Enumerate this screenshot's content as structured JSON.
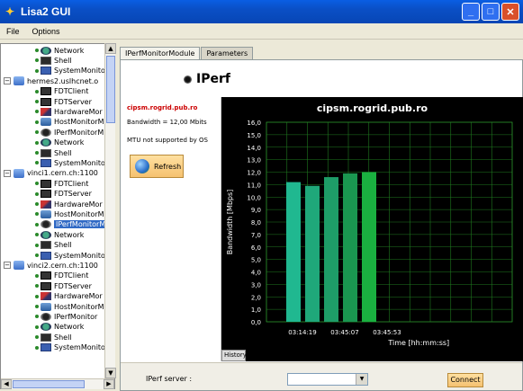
{
  "window": {
    "title": "Lisa2 GUI"
  },
  "menu": [
    "File",
    "Options"
  ],
  "tree": [
    {
      "label": "Network",
      "icon": "network-icon",
      "indent": 2,
      "top": 0
    },
    {
      "label": "Shell",
      "icon": "shell-icon",
      "indent": 2
    },
    {
      "label": "SystemMonito",
      "icon": "system-monitor-icon",
      "indent": 2
    },
    {
      "label": "hermes2.uslhcnet.o",
      "icon": "farm-icon",
      "indent": 0
    },
    {
      "label": "FDTClient",
      "icon": "fdt-client-icon",
      "indent": 2
    },
    {
      "label": "FDTServer",
      "icon": "fdt-server-icon",
      "indent": 2
    },
    {
      "label": "HardwareMor",
      "icon": "hardware-monitor-icon",
      "indent": 2
    },
    {
      "label": "HostMonitorM",
      "icon": "host-monitor-icon",
      "indent": 2
    },
    {
      "label": "IPerfMonitorM",
      "icon": "iperf-monitor-icon",
      "indent": 2
    },
    {
      "label": "Network",
      "icon": "network-icon",
      "indent": 2
    },
    {
      "label": "Shell",
      "icon": "shell-icon",
      "indent": 2
    },
    {
      "label": "SystemMonito",
      "icon": "system-monitor-icon",
      "indent": 2
    },
    {
      "label": "vinci1.cern.ch:1100",
      "icon": "farm-icon",
      "indent": 0
    },
    {
      "label": "FDTClient",
      "icon": "fdt-client-icon",
      "indent": 2
    },
    {
      "label": "FDTServer",
      "icon": "fdt-server-icon",
      "indent": 2
    },
    {
      "label": "HardwareMor",
      "icon": "hardware-monitor-icon",
      "indent": 2
    },
    {
      "label": "HostMonitorM",
      "icon": "host-monitor-icon",
      "indent": 2
    },
    {
      "label": "IPerfMonitorM",
      "icon": "iperf-monitor-icon",
      "indent": 2,
      "selected": true
    },
    {
      "label": "Network",
      "icon": "network-icon",
      "indent": 2
    },
    {
      "label": "Shell",
      "icon": "shell-icon",
      "indent": 2
    },
    {
      "label": "SystemMonito",
      "icon": "system-monitor-icon",
      "indent": 2
    },
    {
      "label": "vinci2.cern.ch:1100",
      "icon": "farm-icon",
      "indent": 0
    },
    {
      "label": "FDTClient",
      "icon": "fdt-client-icon",
      "indent": 2
    },
    {
      "label": "FDTServer",
      "icon": "fdt-server-icon",
      "indent": 2
    },
    {
      "label": "HardwareMor",
      "icon": "hardware-monitor-icon",
      "indent": 2
    },
    {
      "label": "HostMonitorM",
      "icon": "host-monitor-icon",
      "indent": 2
    },
    {
      "label": "IPerfMonitor",
      "icon": "iperf-monitor-icon",
      "indent": 2
    },
    {
      "label": "Network",
      "icon": "network-icon",
      "indent": 2
    },
    {
      "label": "Shell",
      "icon": "shell-icon",
      "indent": 2
    },
    {
      "label": "SystemMonito",
      "icon": "system-monitor-icon",
      "indent": 2
    }
  ],
  "tabs": [
    {
      "label": "IPerfMonitorModule",
      "active": true
    },
    {
      "label": "Parameters",
      "active": false
    }
  ],
  "heading": "IPerf",
  "info": {
    "host": "cipsm.rogrid.pub.ro",
    "bandwidth": "Bandwidth = 12,00 Mbits",
    "mtu": "MTU not supported by OS",
    "refresh_label": "Refresh"
  },
  "chart_data": {
    "type": "bar",
    "title": "cipsm.rogrid.pub.ro",
    "ylabel": "Bandwidth [Mbps]",
    "xlabel": "Time [hh:mm:ss]",
    "ylim": [
      0,
      16
    ],
    "yticks": [
      "0,0",
      "1,0",
      "2,0",
      "3,0",
      "4,0",
      "5,0",
      "6,0",
      "7,0",
      "8,0",
      "9,0",
      "10,0",
      "11,0",
      "12,0",
      "13,0",
      "14,0",
      "15,0",
      "16,0"
    ],
    "xticks": [
      "03:14:19",
      "03:45:07",
      "03:45:53"
    ],
    "values": [
      11.2,
      10.9,
      11.6,
      11.9,
      12.0
    ],
    "colors": [
      "#20b890",
      "#1fa87a",
      "#1e9d68",
      "#1a9650",
      "#1ab040"
    ],
    "grid": true,
    "background": "#000000"
  },
  "history_label": "History",
  "bottom": {
    "server_label": "IPerf server :",
    "server_value": "",
    "connect_label": "Connect"
  }
}
